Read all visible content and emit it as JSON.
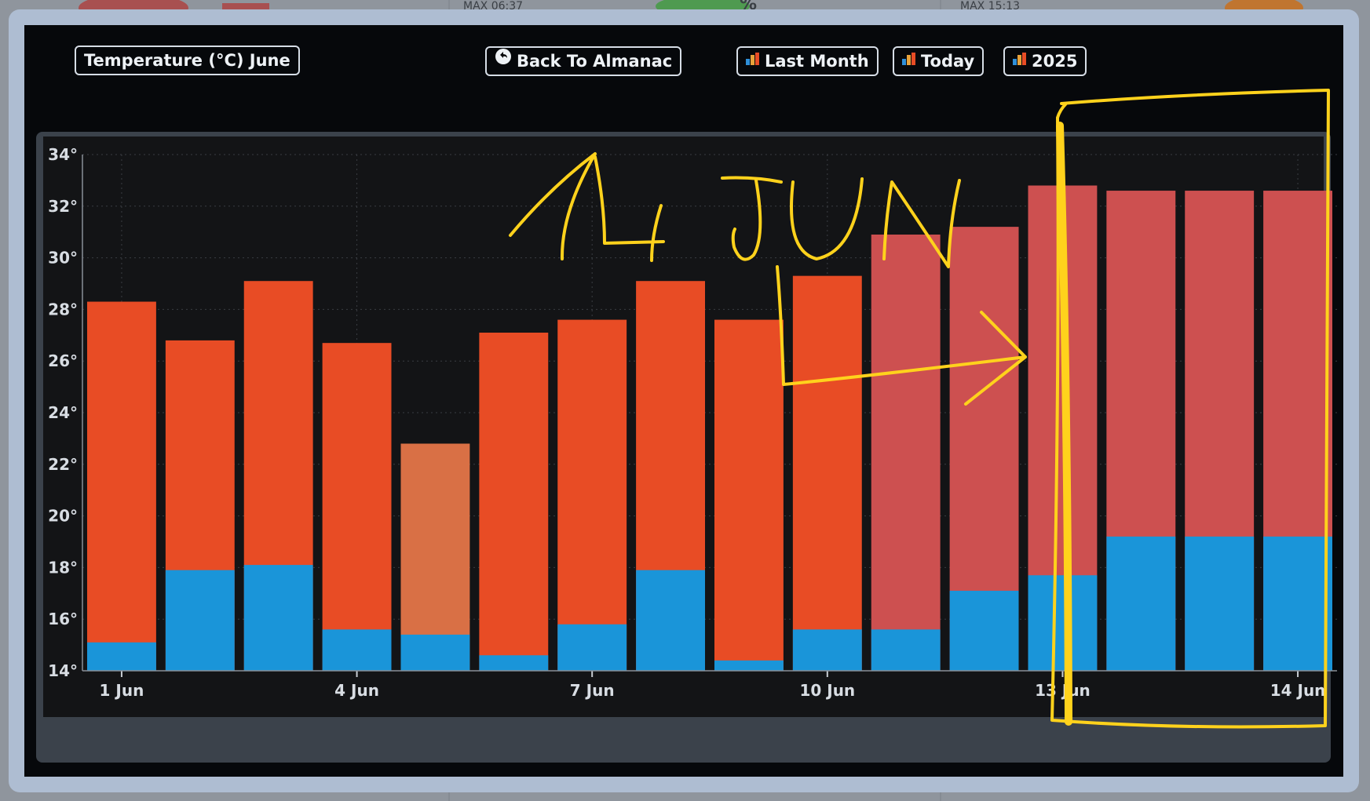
{
  "modal": {
    "title_button": "Temperature (°C) June",
    "back_button": "Back To Almanac",
    "range_buttons": [
      "Last Month",
      "Today",
      "2025"
    ]
  },
  "background_fragments": [
    "MAX 06:37",
    "%",
    "MAX 15:13"
  ],
  "colors": {
    "max_observed": "#e84c25",
    "max_low_day": "#d97045",
    "max_forecast": "#cd5050",
    "min": "#1a95d9",
    "annotation": "#ffd21c"
  },
  "annotation": {
    "text": "14 JUN",
    "note": "handwritten yellow annotation with arrow pointing to a box around the last three bars"
  },
  "chart_data": {
    "type": "bar",
    "title": "Temperature (°C) June",
    "xlabel": "",
    "ylabel": "",
    "ylim": [
      14,
      34
    ],
    "yticks": [
      "14°",
      "16°",
      "18°",
      "20°",
      "22°",
      "24°",
      "26°",
      "28°",
      "30°",
      "32°",
      "34°"
    ],
    "xtick_labels": [
      "1 Jun",
      "4 Jun",
      "7 Jun",
      "10 Jun",
      "13 Jun",
      "14 Jun"
    ],
    "grid": true,
    "categories": [
      "1 Jun",
      "2 Jun",
      "3 Jun",
      "4 Jun",
      "5 Jun",
      "6 Jun",
      "7 Jun",
      "8 Jun",
      "9 Jun",
      "10 Jun",
      "11 Jun",
      "12 Jun",
      "13 Jun",
      "14 Jun",
      "14 Jun",
      "14 Jun"
    ],
    "series": [
      {
        "values": [
          28.3,
          26.8,
          29.1,
          26.7,
          22.8,
          27.1,
          27.6,
          29.1,
          27.6,
          29.3,
          30.9,
          31.2,
          32.8,
          32.6,
          32.6,
          32.6
        ]
      },
      {
        "values": [
          15.1,
          17.9,
          18.1,
          15.6,
          15.4,
          14.6,
          15.8,
          17.9,
          14.4,
          15.6,
          15.6,
          17.1,
          17.7,
          19.2,
          19.2,
          19.2
        ]
      }
    ],
    "bar_kinds": [
      "obs",
      "obs",
      "obs",
      "obs",
      "low",
      "obs",
      "obs",
      "obs",
      "obs",
      "obs",
      "fc",
      "fc",
      "fc",
      "fc",
      "fc",
      "fc"
    ]
  }
}
